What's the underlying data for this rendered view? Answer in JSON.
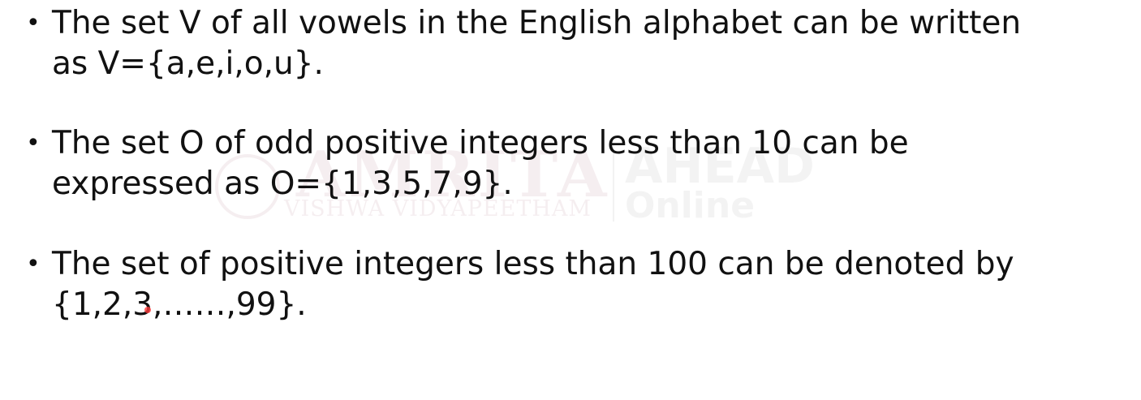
{
  "watermark": {
    "word": "AMRITA",
    "subtitle": "VISHWA VIDYAPEETHAM",
    "brand": "AHEAD",
    "online": "Online"
  },
  "bullets": [
    {
      "marker": "•",
      "text": "The set V of all vowels in the English alphabet can be written\nas V={a,e,i,o,u}."
    },
    {
      "marker": "•",
      "text": "The set O of odd positive integers less than 10 can be\nexpressed as O={1,3,5,7,9}."
    },
    {
      "marker": "•",
      "text": "The set of positive integers less than 100 can be denoted by\n{1,2,3,……,99}."
    }
  ],
  "colors": {
    "text": "#111111",
    "background": "#ffffff",
    "pointer": "#ff3b3b"
  }
}
